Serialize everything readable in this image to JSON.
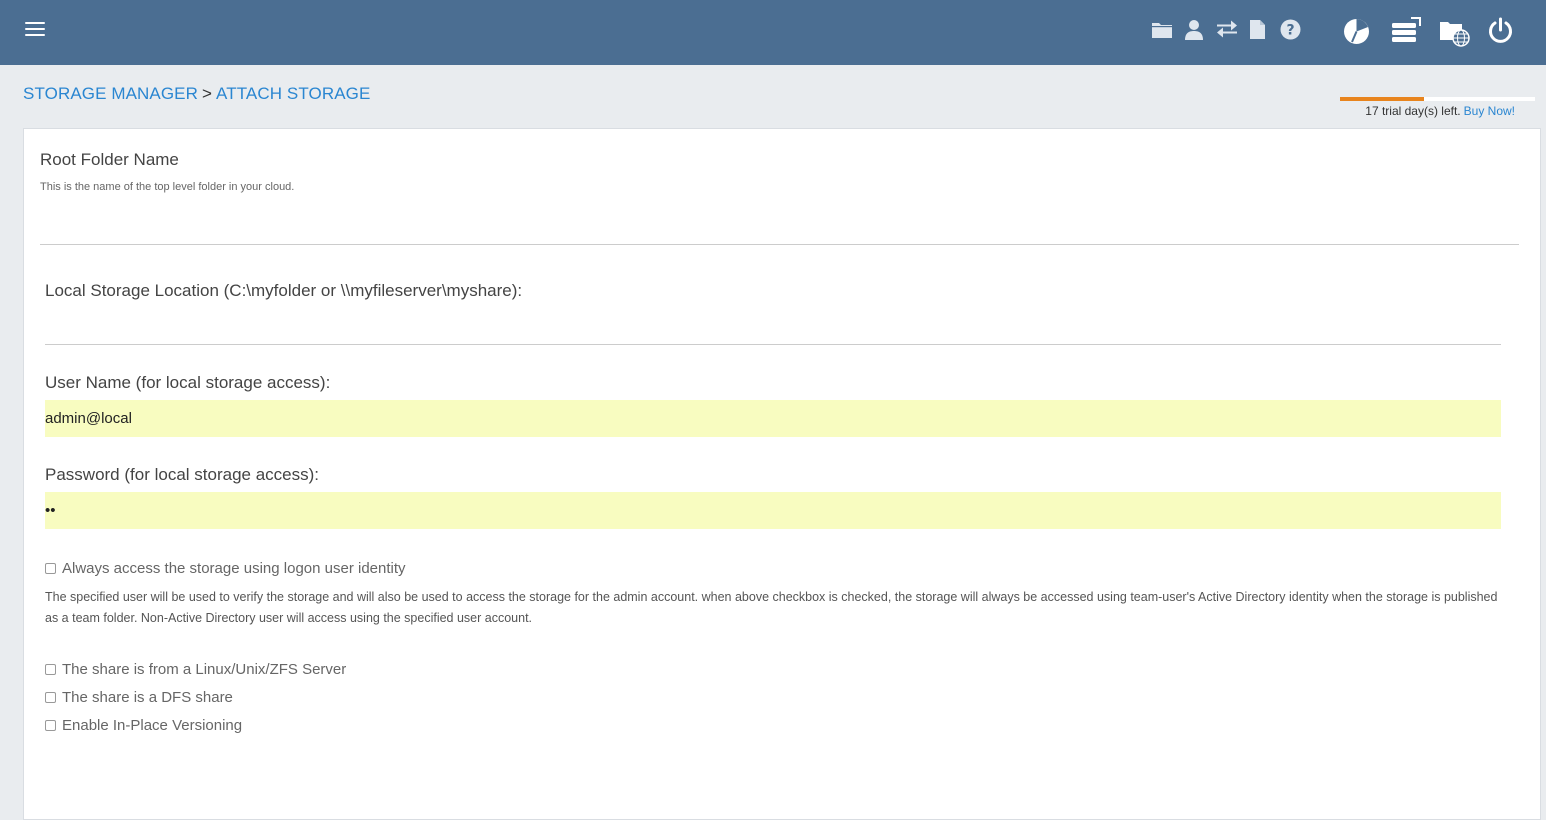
{
  "breadcrumb": {
    "root": "STORAGE MANAGER",
    "separator": ">",
    "current": "ATTACH STORAGE"
  },
  "trial": {
    "text": "17 trial day(s) left.",
    "link": "Buy Now!",
    "progress_fraction": 0.43,
    "bar_color": "#e8841d"
  },
  "topbar": {
    "background": "#4b6e92",
    "icons": [
      "menu-icon",
      "folder-icon",
      "user-icon",
      "transfer-icon",
      "document-icon",
      "help-icon",
      "dashboard-icon",
      "server-icon",
      "network-folder-icon",
      "power-icon"
    ]
  },
  "form": {
    "root_folder": {
      "label": "Root Folder Name",
      "hint": "This is the name of the top level folder in your cloud.",
      "value": ""
    },
    "local_storage": {
      "label": "Local Storage Location (C:\\myfolder or \\\\myfileserver\\myshare):",
      "value": ""
    },
    "username": {
      "label": "User Name (for local storage access):",
      "value": "admin@local"
    },
    "password": {
      "label": "Password (for local storage access):",
      "value": "••"
    },
    "always_access": {
      "label": "Always access the storage using logon user identity",
      "checked": false
    },
    "description": "The specified user will be used to verify the storage and will also be used to access the storage for the admin account. when above checkbox is checked, the storage will always be accessed using team-user's Active Directory identity when the storage is published as a team folder. Non-Active Directory user will access using the specified user account.",
    "linux_share": {
      "label": "The share is from a Linux/Unix/ZFS Server",
      "checked": false
    },
    "dfs_share": {
      "label": "The share is a DFS share",
      "checked": false
    },
    "versioning": {
      "label": "Enable In-Place Versioning",
      "checked": false
    }
  },
  "colors": {
    "accent": "#2a86d1",
    "input_fill": "#f8fcc0"
  }
}
